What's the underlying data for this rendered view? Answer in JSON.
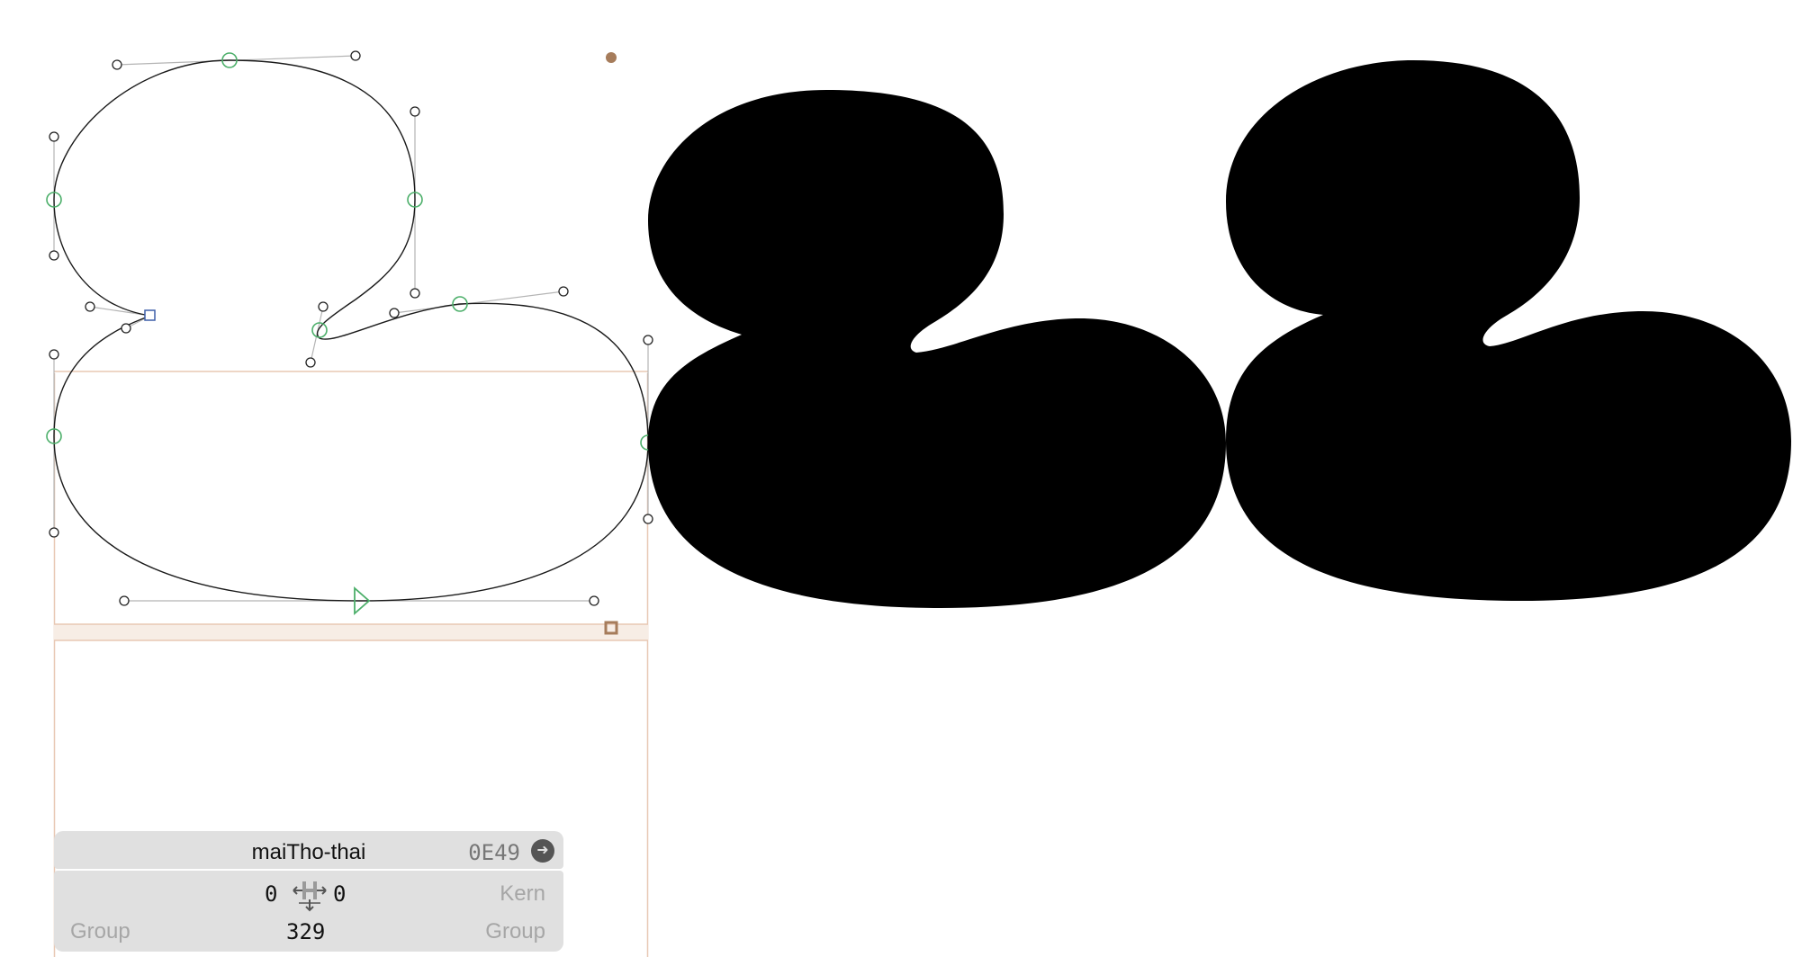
{
  "glyph": {
    "name": "maiTho-thai",
    "unicode": "0E49",
    "left_sidebearing": "0",
    "right_sidebearing": "0",
    "width": "329",
    "left_group_placeholder": "Group",
    "right_group_placeholder": "Group",
    "kern_placeholder": "Kern"
  },
  "icons": {
    "next_glyph": "arrow-right-circle-icon",
    "metrics": "sidebearing-metrics-icon"
  },
  "colors": {
    "outline": "#1a1a1a",
    "on_curve_node": "#4caf6a",
    "start_node": "#3d5fa8",
    "metrics_line": "#e8c8b4",
    "anchor": "#a67c5b",
    "preview_fill": "#000000",
    "panel_bg": "#e0e0e0"
  }
}
